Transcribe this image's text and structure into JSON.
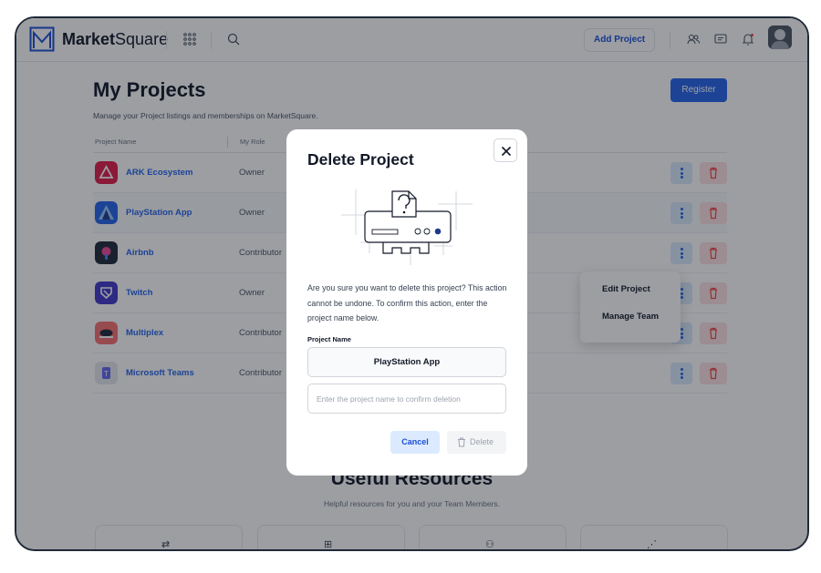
{
  "header": {
    "brand_bold": "Market",
    "brand_rest": "Square",
    "add_project_label": "Add Project",
    "icons": [
      "logo-icon",
      "apps-grid-icon",
      "search-icon",
      "users-icon",
      "chat-icon",
      "bell-icon",
      "avatar"
    ]
  },
  "page": {
    "title": "My Projects",
    "subtitle": "Manage your Project listings and memberships on MarketSquare.",
    "register_label": "Register",
    "columns": [
      "Project Name",
      "My Role"
    ],
    "projects": [
      {
        "name": "ARK Ecosystem",
        "role": "Owner",
        "logo_color": "#e11d48"
      },
      {
        "name": "PlayStation App",
        "role": "Owner",
        "logo_color": "#2563eb"
      },
      {
        "name": "Airbnb",
        "role": "Contributor",
        "logo_color": "#1f2937"
      },
      {
        "name": "Twitch",
        "role": "Owner",
        "logo_color": "#4338ca"
      },
      {
        "name": "Multiplex",
        "role": "Contributor",
        "logo_color": "#f87171"
      },
      {
        "name": "Microsoft Teams",
        "role": "Contributor",
        "logo_color": "#e5e7eb"
      }
    ],
    "dropdown": {
      "items": [
        "Edit Project",
        "Manage Team"
      ]
    }
  },
  "resources": {
    "title": "Useful Resources",
    "subtitle": "Helpful resources for you and your Team Members."
  },
  "modal": {
    "title": "Delete Project",
    "message": "Are you sure you want to delete this project? This action cannot be undone. To confirm this action, enter the project name below.",
    "field_label": "Project Name",
    "project_name": "PlayStation App",
    "input_placeholder": "Enter the project name to confirm deletion",
    "cancel_label": "Cancel",
    "delete_label": "Delete"
  },
  "colors": {
    "accent": "#2563eb",
    "danger_bg": "#fee2e2",
    "overlay": "rgba(20,24,33,0.42)"
  }
}
